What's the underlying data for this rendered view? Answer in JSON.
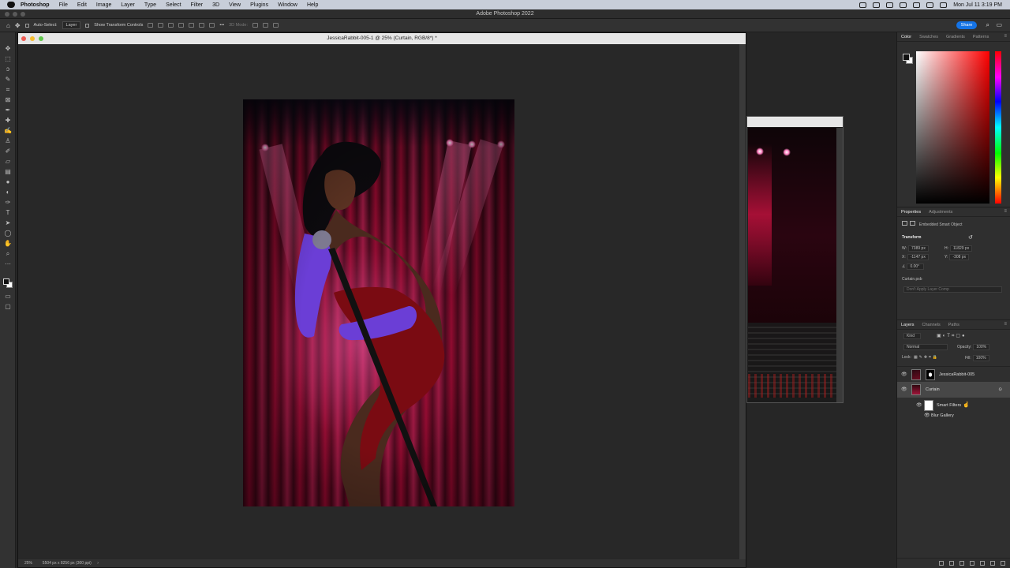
{
  "menubar": {
    "app": "Photoshop",
    "items": [
      "File",
      "Edit",
      "Image",
      "Layer",
      "Type",
      "Select",
      "Filter",
      "3D",
      "View",
      "Plugins",
      "Window",
      "Help"
    ],
    "clock": "Mon Jul 11  3:19 PM"
  },
  "app_title": "Adobe Photoshop 2022",
  "options": {
    "auto_select": "Auto-Select:",
    "auto_select_target": "Layer",
    "show_transform": "Show Transform Controls",
    "mode_3d": "3D Mode:",
    "share": "Share"
  },
  "document": {
    "title": "JessicaRabbit-005-1 @ 25% (Curtain, RGB/8*) *",
    "zoom": "25%",
    "info": "5504 px x 8256 px (300 ppi)"
  },
  "color_panel": {
    "tabs": [
      "Color",
      "Swatches",
      "Gradients",
      "Patterns"
    ],
    "active_tab": "Color",
    "fg_color": "#111111",
    "bg_color": "#ffffff"
  },
  "properties": {
    "tabs": [
      "Properties",
      "Adjustments"
    ],
    "active_tab": "Properties",
    "kind": "Embedded Smart Object",
    "section": "Transform",
    "w_label": "W:",
    "w": "7389 px",
    "h_label": "H:",
    "h": "11829 px",
    "x_label": "X:",
    "x": "-1147 px",
    "y_label": "Y:",
    "y": "-308 px",
    "angle": "0.00°",
    "file": "Curtain.psb",
    "layer_comp": "Don't Apply Layer Comp"
  },
  "layers": {
    "tabs": [
      "Layers",
      "Channels",
      "Paths"
    ],
    "active_tab": "Layers",
    "filter": "Kind",
    "blend_mode": "Normal",
    "opacity_label": "Opacity:",
    "opacity": "100%",
    "lock_label": "Lock:",
    "fill_label": "Fill:",
    "fill": "100%",
    "items": [
      {
        "name": "JessicaRabbit-005"
      },
      {
        "name": "Curtain"
      },
      {
        "name": "Smart Filters"
      },
      {
        "name": "Blur Gallery"
      }
    ]
  },
  "accent_color": "#1473e6"
}
